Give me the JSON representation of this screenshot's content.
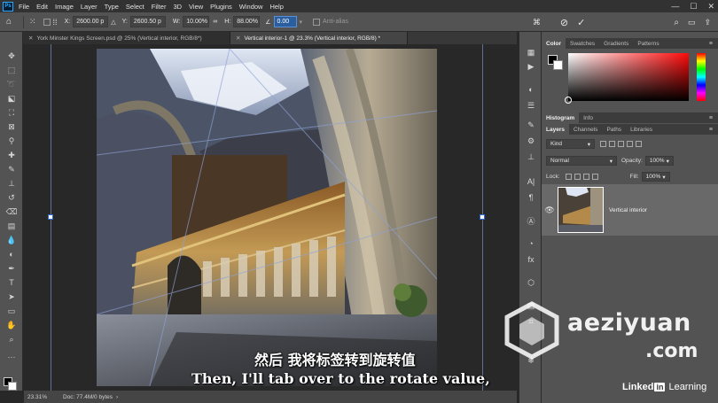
{
  "app": {
    "logo": "Ps"
  },
  "menu": [
    "File",
    "Edit",
    "Image",
    "Layer",
    "Type",
    "Select",
    "Filter",
    "3D",
    "View",
    "Plugins",
    "Window",
    "Help"
  ],
  "options_bar": {
    "x_label": "X:",
    "x_value": "2600.00 p",
    "y_label": "Y:",
    "y_value": "2600.50 p",
    "w_label": "W:",
    "w_value": "10.00%",
    "h_label": "H:",
    "h_value": "88.00%",
    "angle_value": "0.00",
    "antialias_label": "Anti-alias"
  },
  "tabs": [
    {
      "label": "York Minster Kings Screen.psd @ 25% (Vertical interior, RGB/8*)",
      "active": false
    },
    {
      "label": "Vertical interior-1 @ 23.3% (Vertical interior, RGB/8) *",
      "active": true
    }
  ],
  "status": {
    "zoom": "23.31%",
    "doc": "Doc: 77.4M/0 bytes"
  },
  "subtitles": {
    "chinese": "然后 我将标签转到旋转值",
    "english": "Then, I'll tab over to the rotate value,"
  },
  "panels": {
    "color_tabs": [
      "Color",
      "Swatches",
      "Gradients",
      "Patterns"
    ],
    "info_tabs": [
      "Histogram",
      "Info"
    ],
    "layer_tabs": [
      "Layers",
      "Channels",
      "Paths",
      "Libraries"
    ],
    "kind_placeholder": "Kind",
    "blend_mode": "Normal",
    "opacity_label": "Opacity:",
    "opacity_value": "100%",
    "lock_label": "Lock:",
    "fill_label": "Fill:",
    "fill_value": "100%",
    "layer_name": "Vertical interior"
  },
  "watermark": {
    "site": "aeziyuan",
    "tld": ".com"
  },
  "brand": {
    "linked": "Linked",
    "in": "in",
    "learning": "Learning"
  },
  "colors": {
    "selection_blue": "#2b5e9f",
    "panel_gray": "#535353",
    "canvas_bg": "#282828"
  }
}
